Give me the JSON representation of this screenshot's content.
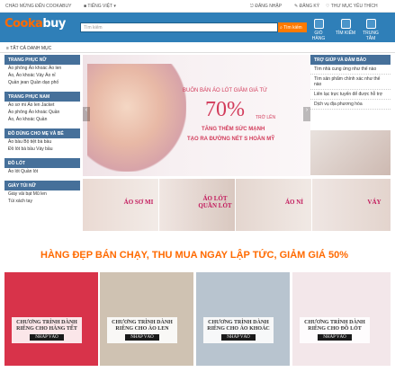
{
  "topbar": {
    "welcome": "CHÀO MỪNG ĐẾN COOKABUY",
    "language": "TIẾNG VIỆT",
    "login": "ĐĂNG NHẬP",
    "register": "ĐĂNG KÝ",
    "wishlist": "THƯ MỤC YÊU THÍCH"
  },
  "header": {
    "logo_main": "Cooka",
    "logo_tail": "buy",
    "search_placeholder": "Tìm kiếm",
    "search_button": "Tìm kiếm",
    "icons": [
      {
        "icon": "cart-icon",
        "label": "GIỎ HÀNG"
      },
      {
        "icon": "search-image-icon",
        "label": "TÌM KIẾM"
      },
      {
        "icon": "help-icon",
        "label": "TRUNG TÂM"
      }
    ]
  },
  "category_bar": {
    "label": "TẤT CẢ DANH MỤC"
  },
  "sidebar": [
    {
      "title": "TRANG PHỤC NỮ",
      "items": [
        "Áo phông   Áo khoác   Áo len",
        "Áo, Áo khoác   Váy   Áo nỉ",
        "Quần jean   Quần dạo phố"
      ]
    },
    {
      "title": "TRANG PHỤC NAM",
      "items": [
        "Áo sơ mi   Áo len   Jacket",
        "Áo phông   Áo khoác   Quần",
        "Áo, Áo khoác   Quần"
      ]
    },
    {
      "title": "ĐỒ DÙNG CHO MẸ VÀ BÉ",
      "items": [
        "Áo bầu   Bộ tiệt bà bầu",
        "Đồ lót bà bầu   Váy bầu"
      ]
    },
    {
      "title": "ĐỒ LÓT",
      "items": [
        "Áo lót   Quần lót"
      ]
    },
    {
      "title": "GIÀY TÚI NỮ",
      "items": [
        "Giày vải bạt   Mũ len",
        "Túi xách tay"
      ]
    }
  ],
  "banner": {
    "line1": "BUÔN BÁN ÁO LÓT GIẢM GIÁ TỪ",
    "percent": "70%",
    "suffix": "TRỞ LÊN",
    "line4": "TĂNG THÊM SỨC MẠNH",
    "line5": "TẠO RA ĐƯỜNG NÉT S HOÀN MỸ"
  },
  "help": {
    "title": "TRỢ GIÚP VÀ ĐẢM BẢO",
    "items": [
      "Tìm nhà cung ứng như thế nào",
      "Tìm sản phẩm chính xác như thế nào",
      "Liên lạc trực tuyến để được hỗ trợ",
      "Dịch vụ địa phương hóa"
    ]
  },
  "tiles": [
    {
      "label": "ÁO SƠ MI"
    },
    {
      "label": "ÁO LÓT QUẦN LÓT"
    },
    {
      "label": "ÁO NỈ"
    },
    {
      "label": "VÁY"
    }
  ],
  "promo": {
    "text": "HÀNG ĐẸP BÁN CHẠY, THU MUA NGAY LẬP TỨC, GIẢM GIÁ 50%"
  },
  "cards": [
    {
      "title": "CHƯƠNG TRÌNH DÀNH RIÊNG CHO HÀNG TẾT",
      "button": "NHẤP VÀO",
      "bg": "#d8334a"
    },
    {
      "title": "CHƯƠNG TRÌNH DÀNH RIÊNG CHO ÁO LEN",
      "button": "NHẤP VÀO",
      "bg": "#cfc2b2"
    },
    {
      "title": "CHƯƠNG TRÌNH DÀNH RIÊNG CHO ÁO KHOÁC",
      "button": "NHẤP VÀO",
      "bg": "#b8c4cf"
    },
    {
      "title": "CHƯƠNG TRÌNH DÀNH RIÊNG CHO ĐỒ LÓT",
      "button": "NHẤP VÀO",
      "bg": "#f3e7ea"
    }
  ],
  "colors": {
    "header": "#2f7fb8",
    "accent": "#ff6a00",
    "sidebar": "#46709a"
  }
}
